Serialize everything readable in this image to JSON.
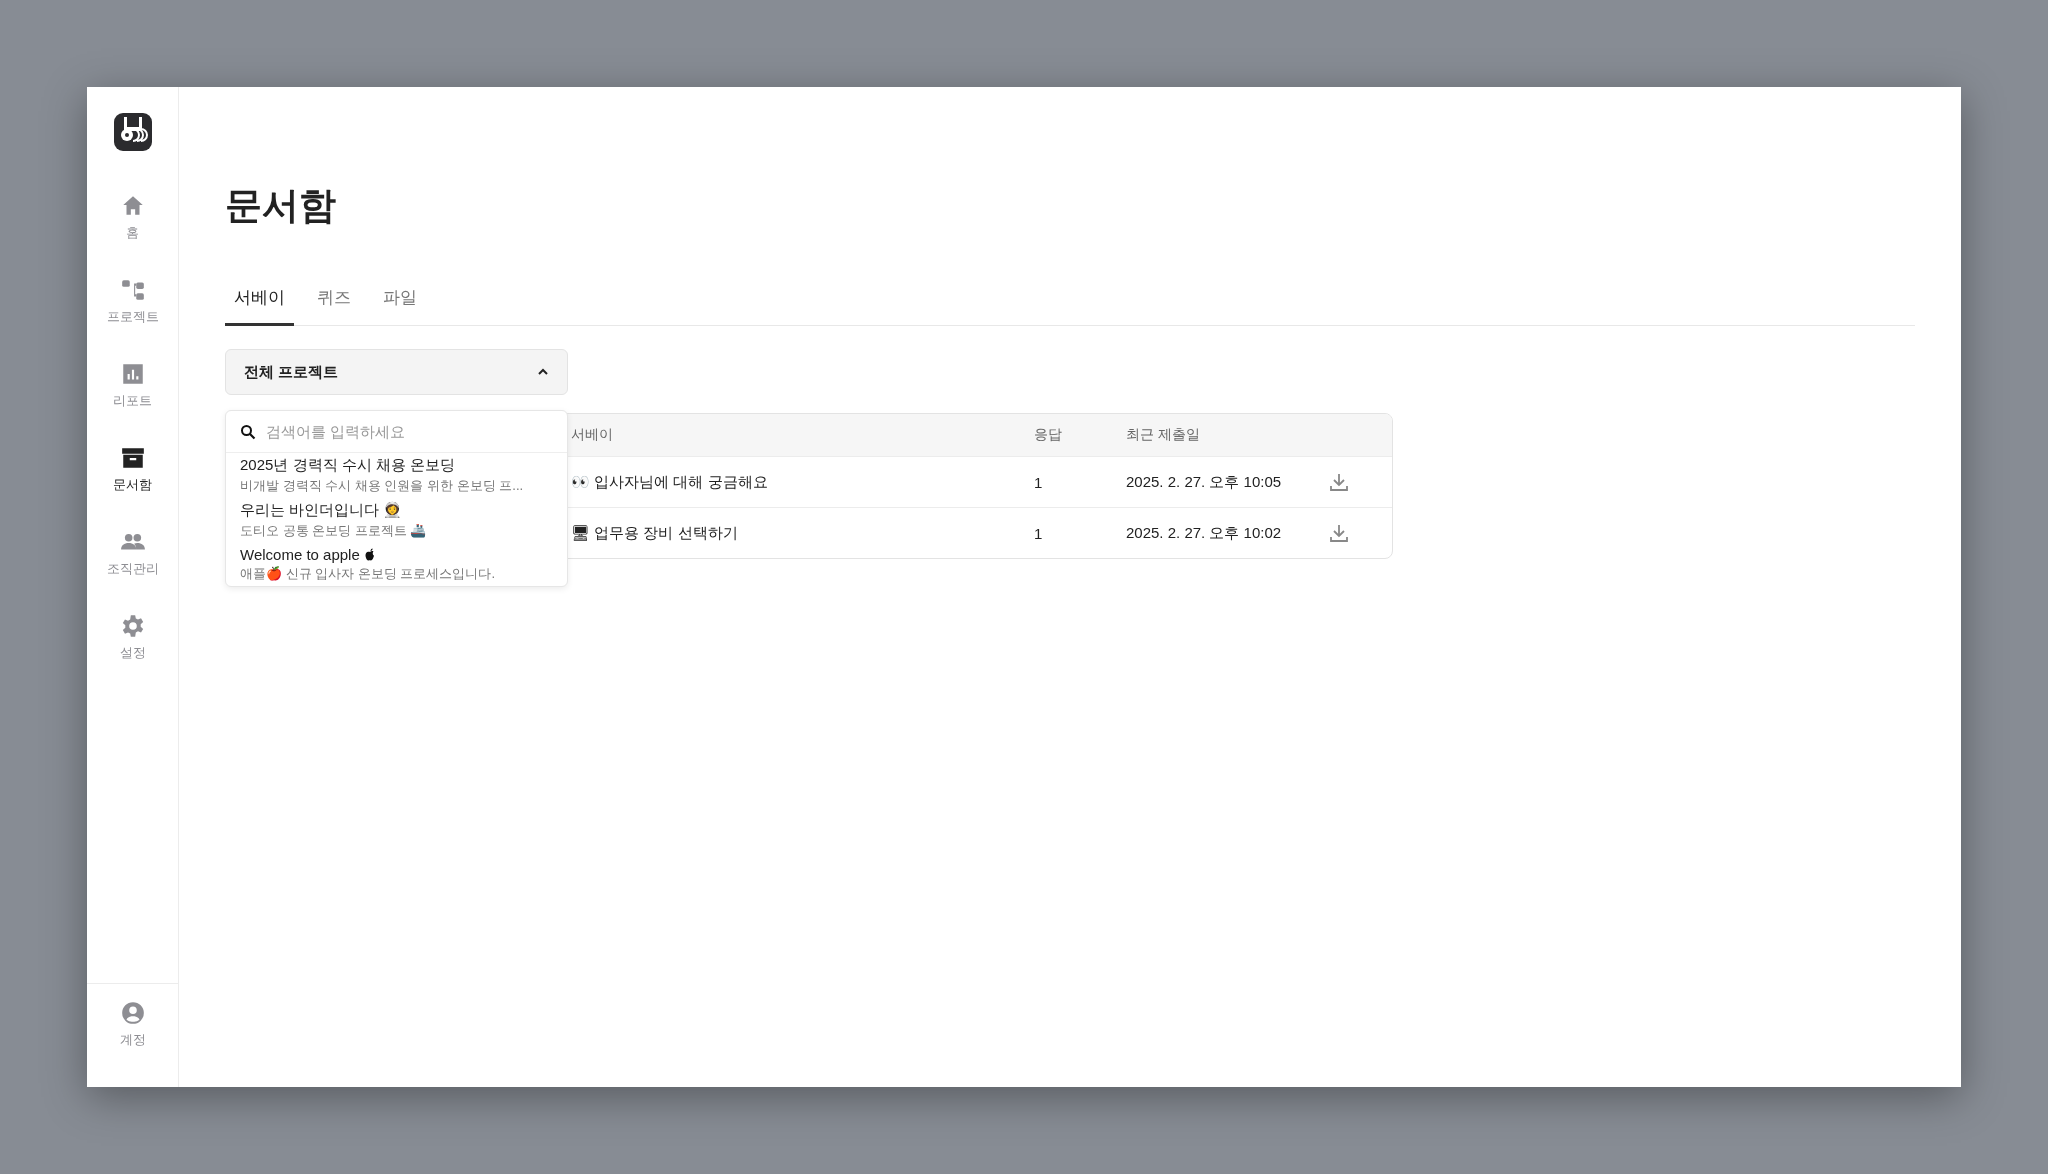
{
  "sidebar": {
    "items": [
      {
        "label": "홈",
        "selected": false
      },
      {
        "label": "프로젝트",
        "selected": false
      },
      {
        "label": "리포트",
        "selected": false
      },
      {
        "label": "문서함",
        "selected": true
      },
      {
        "label": "조직관리",
        "selected": false
      },
      {
        "label": "설정",
        "selected": false
      }
    ],
    "account": {
      "label": "계정"
    }
  },
  "page_title": "문서함",
  "tabs": [
    {
      "label": "서베이",
      "selected": true
    },
    {
      "label": "퀴즈",
      "selected": false
    },
    {
      "label": "파일",
      "selected": false
    }
  ],
  "project_filter": {
    "value": "전체 프로젝트",
    "expanded": true,
    "search": {
      "placeholder": "검색어를 입력하세요"
    },
    "options": [
      {
        "title": "2025년 경력직 수시 채용 온보딩",
        "subtitle": "비개발 경력직 수시 채용 인원을 위한 온보딩 프..."
      },
      {
        "title": "우리는 바인더입니다 👩‍🚀",
        "subtitle": "도티오 공통 온보딩 프로젝트 🚢"
      },
      {
        "title": "Welcome to apple",
        "subtitle": "애플🍎 신규 입사자 온보딩 프로세스입니다."
      }
    ]
  },
  "table": {
    "columns": [
      "서베이",
      "응답",
      "최근 제출일"
    ],
    "rows": [
      {
        "survey": "👀 입사자님에 대해 궁금해요",
        "responses": "1",
        "last_submitted": "2025. 2. 27. 오후 10:05"
      },
      {
        "survey": "🖥 업무용 장비 선택하기",
        "responses": "1",
        "last_submitted": "2025. 2. 27. 오후 10:02"
      }
    ]
  }
}
